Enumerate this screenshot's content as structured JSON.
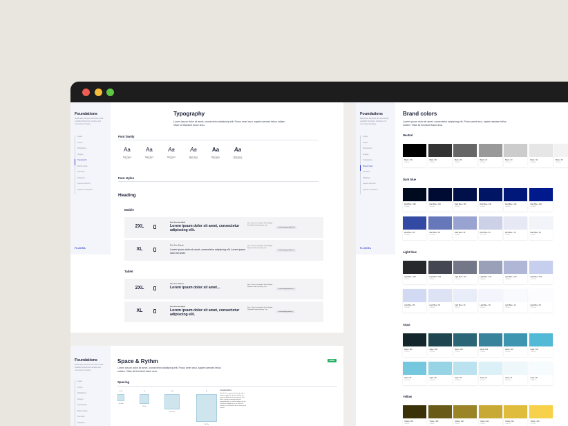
{
  "window": {
    "controls": [
      "close",
      "minimize",
      "maximize"
    ]
  },
  "typography_page": {
    "sidebar": {
      "heading": "Foundations",
      "description": "Build base elements and theme that establish Fluidora's interface and most shared singles.",
      "items": [
        "Logos",
        "Colors",
        "Illustrations",
        "Images",
        "Typography",
        "Brand colors",
        "Iconsfont",
        "Shadows",
        "Layout and Grid",
        "Spaces and Rythm"
      ],
      "active_index": 4,
      "logo": "FLUIDRA"
    },
    "title": "Typography",
    "intro": "Lorem ipsum dolor sit amet, consectetur adipiscing elit. Purus amet arcu, sapien aenean tellus nullam. Vitae sit tincidunt fusce arcu.",
    "font_family": {
      "heading": "Font family",
      "cards": [
        {
          "glyph": "Aa",
          "name": "Work Sans",
          "weight": "Regular",
          "style": "normal",
          "bold": false
        },
        {
          "glyph": "Aa",
          "name": "Work Sans",
          "weight": "Medium",
          "style": "normal",
          "bold": false
        },
        {
          "glyph": "Aa",
          "name": "Work Sans",
          "weight": "Italic",
          "style": "italic",
          "bold": false
        },
        {
          "glyph": "Aa",
          "name": "Work Sans",
          "weight": "Medium Italic",
          "style": "italic",
          "bold": false
        },
        {
          "glyph": "Aa",
          "name": "Work Sans",
          "weight": "SemiBold",
          "style": "normal",
          "bold": true
        },
        {
          "glyph": "Aa",
          "name": "Work Sans",
          "weight": "SemiBold Italic",
          "style": "italic",
          "bold": true
        }
      ]
    },
    "font_styles": {
      "heading": "Font styles",
      "group": "Heading",
      "mobile": {
        "label": "Mobile",
        "rows": [
          {
            "size": "2XL",
            "label": "Work Sans SemiBold",
            "text": "Lorem ipsum dolor sit amet, consectetur adipiscing elit.",
            "meta": "Size: 24 px Line height: 32 px Weight: Semibold Letter Spacing: 0 px",
            "tag": "font-heading-mobile-2xl",
            "thin": false
          },
          {
            "size": "XL",
            "label": "Work Sans Regular",
            "text": "Lorem ipsum dolor sit amet, consectetur adipiscing elit. Lorem ipsum dolor sit amet.",
            "meta": "Size: 16 px Line height: 24 px Weight: Regular Letter Spacing: 0 px",
            "tag": "font-heading-mobile-xl",
            "thin": true
          }
        ]
      },
      "tablet": {
        "label": "Tablet",
        "rows": [
          {
            "size": "2XL",
            "label": "Work Sans Medium",
            "text": "Lorem ipsum dolor sit amet...",
            "meta": "Size: 28 px Line height: 36 px Weight: Medium Letter Spacing: 0 px",
            "tag": "font-heading-tablet-2xl",
            "thin": false
          },
          {
            "size": "XL",
            "label": "Work Sans SemiBold",
            "text": "Lorem ipsum dolor sit amet, consectetur adipiscing elit.",
            "meta": "Size: 24 px Line height: 32 px Weight: Semibold Letter Spacing: 0 px",
            "tag": "font-heading-tablet-xl",
            "thin": false
          }
        ]
      }
    }
  },
  "brand_page": {
    "sidebar": {
      "heading": "Foundations",
      "description": "Build base elements and theme that establish Fluidora's interface and most shared singles.",
      "items": [
        "Logos",
        "Colors",
        "Illustrations",
        "Images",
        "Typography",
        "Brand colors",
        "Iconsfont",
        "Shadows",
        "Layout and Grid",
        "Spaces and Rythm"
      ],
      "active_index": 5,
      "logo": "FLUIDRA"
    },
    "title": "Brand colors",
    "intro": "Lorem ipsum dolor sit amet, consectetur adipiscing elit. Purus amet arcu, sapien aenean tellus nullam. Vitae sit tincidunt fusce arcu.",
    "groups": [
      {
        "name": "Neutral",
        "rows": [
          [
            {
              "label": "Black / 100",
              "hex": "#000000",
              "color": "#000000"
            },
            {
              "label": "Black / 80",
              "hex": "#333333",
              "color": "#333333"
            },
            {
              "label": "Black / 60",
              "hex": "#666666",
              "color": "#666666"
            },
            {
              "label": "Black / 40",
              "hex": "#999999",
              "color": "#999999"
            },
            {
              "label": "Black / 20",
              "hex": "#CCCCCC",
              "color": "#cccccc"
            },
            {
              "label": "Black / 10",
              "hex": "#E6E6E6",
              "color": "#e6e6e6"
            },
            {
              "label": "Black / 05",
              "hex": "#F2F2F2",
              "color": "#f2f2f2"
            }
          ]
        ]
      },
      {
        "name": "Dark blue",
        "rows": [
          [
            {
              "label": "Dark Blue / 180",
              "hex": "#000A1F",
              "color": "#000a1f"
            },
            {
              "label": "Dark Blue / 160",
              "hex": "#000B33",
              "color": "#000b33"
            },
            {
              "label": "Dark Blue / 140",
              "hex": "#001048",
              "color": "#001048"
            },
            {
              "label": "Dark Blue / 120",
              "hex": "#001563",
              "color": "#001563"
            },
            {
              "label": "Dark Blue / 110",
              "hex": "#00187A",
              "color": "#00187a"
            },
            {
              "label": "Dark Blue / 100",
              "hex": "#001A8D",
              "color": "#001a8d"
            }
          ],
          [
            {
              "label": "Dark Blue / 80",
              "hex": "#334AA4",
              "color": "#334aa4"
            },
            {
              "label": "Dark Blue / 60",
              "hex": "#6677BA",
              "color": "#6677ba"
            },
            {
              "label": "Dark Blue / 40",
              "hex": "#99A3D1",
              "color": "#99a3d1"
            },
            {
              "label": "Dark Blue / 20",
              "hex": "#CCD1E8",
              "color": "#ccd1e8"
            },
            {
              "label": "Dark Blue / 10",
              "hex": "#E6E8F4",
              "color": "#e6e8f4"
            },
            {
              "label": "Dark Blue / 05",
              "hex": "#F2F4F9",
              "color": "#f2f4f9"
            }
          ]
        ]
      },
      {
        "name": "Light blue",
        "rows": [
          [
            {
              "label": "Light Blue / 180",
              "hex": "#27282C",
              "color": "#27282c"
            },
            {
              "label": "Light Blue / 160",
              "hex": "#444652",
              "color": "#444652"
            },
            {
              "label": "Light Blue / 140",
              "hex": "#747788",
              "color": "#747788"
            },
            {
              "label": "Light Blue / 120",
              "hex": "#9BA0B9",
              "color": "#9ba0b9"
            },
            {
              "label": "Light Blue / 110",
              "hex": "#B0B7D6",
              "color": "#b0b7d6"
            },
            {
              "label": "Light Blue / 100",
              "hex": "#C7CFEF",
              "color": "#c7cfef"
            }
          ],
          [
            {
              "label": "Light Blue / 80",
              "hex": "#D2D9F2",
              "color": "#d2d9f2"
            },
            {
              "label": "Light Blue / 60",
              "hex": "#DDE2F5",
              "color": "#dde2f5"
            },
            {
              "label": "Light Blue / 40",
              "hex": "#E9ECF9",
              "color": "#e9ecf9"
            },
            {
              "label": "Light Blue / 20",
              "hex": "#F4F5FC",
              "color": "#f4f5fc"
            },
            {
              "label": "Light Blue / 10",
              "hex": "#F9FAFD",
              "color": "#f9fafd"
            },
            {
              "label": "Light Blue / 05",
              "hex": "#FCFCFE",
              "color": "#fcfcfe"
            }
          ]
        ]
      },
      {
        "name": "Aqua",
        "rows": [
          [
            {
              "label": "Aqua / 180",
              "hex": "#13262C",
              "color": "#13262c"
            },
            {
              "label": "Aqua / 160",
              "hex": "#1F4650",
              "color": "#1f4650"
            },
            {
              "label": "Aqua / 140",
              "hex": "#2C6676",
              "color": "#2c6676"
            },
            {
              "label": "Aqua / 120",
              "hex": "#37839B",
              "color": "#37839b"
            },
            {
              "label": "Aqua / 110",
              "hex": "#3E95B0",
              "color": "#3e95b0"
            },
            {
              "label": "Aqua / 100",
              "hex": "#52B9D6",
              "color": "#52b9d6"
            }
          ],
          [
            {
              "label": "Aqua / 80",
              "hex": "#75C7DE",
              "color": "#75c7de"
            },
            {
              "label": "Aqua / 60",
              "hex": "#97D5E6",
              "color": "#97d5e6"
            },
            {
              "label": "Aqua / 40",
              "hex": "#BAE3EF",
              "color": "#bae3ef"
            },
            {
              "label": "Aqua / 20",
              "hex": "#DCF1F7",
              "color": "#dcf1f7"
            },
            {
              "label": "Aqua / 10",
              "hex": "#EEF8FB",
              "color": "#eef8fb"
            },
            {
              "label": "Aqua / 05",
              "hex": "#F6FBFD",
              "color": "#f6fbfd"
            }
          ]
        ]
      },
      {
        "name": "Yellow",
        "rows": [
          [
            {
              "label": "Yellow / 180",
              "hex": "#3A3108",
              "color": "#3a3108"
            },
            {
              "label": "Yellow / 160",
              "hex": "#6A5A17",
              "color": "#6a5a17"
            },
            {
              "label": "Yellow / 140",
              "hex": "#9B8427",
              "color": "#9b8427"
            },
            {
              "label": "Yellow / 120",
              "hex": "#C9A935",
              "color": "#c9a935"
            },
            {
              "label": "Yellow / 110",
              "hex": "#E0BC3D",
              "color": "#e0bc3d"
            },
            {
              "label": "Yellow / 100",
              "hex": "#F7D149",
              "color": "#f7d149"
            }
          ]
        ]
      }
    ]
  },
  "space_page": {
    "sidebar": {
      "heading": "Foundations",
      "description": "Build base elements and theme that establish Fluidora's interface and most shared singles.",
      "items": [
        "Logos",
        "Colors",
        "Illustrations",
        "Images",
        "Typography",
        "Brand colors",
        "Iconsfont",
        "Shadows",
        "Layout and Grid",
        "Spaces and Rythm"
      ]
    },
    "title": "Space & Rythm",
    "badge": "DONE",
    "intro": "Lorem ipsum dolor sit amet, consectetur adipiscing elit. Purus amet arcu, sapien aenean tellus nullam. Vitae sit tincidunt fusce arcu.",
    "spacing_heading": "Spacing",
    "squares": [
      {
        "label": "0.5x",
        "caption": "4 / 0.5x"
      },
      {
        "label": "1x",
        "caption": "8 / 1x"
      },
      {
        "label": "1.5x",
        "caption": "12 / 1.5x"
      },
      {
        "label": "2x",
        "caption": "16 / 2x"
      }
    ],
    "note_heading": "Considerations",
    "note": "The Grid is compound of pixel values and according to column rhythm for spacing. Adhering to increments of 8 offers a great harmony between proportionality, as each number can be scaled to multiply by 4, as well as 8, mostly the alternative offers many more options."
  }
}
